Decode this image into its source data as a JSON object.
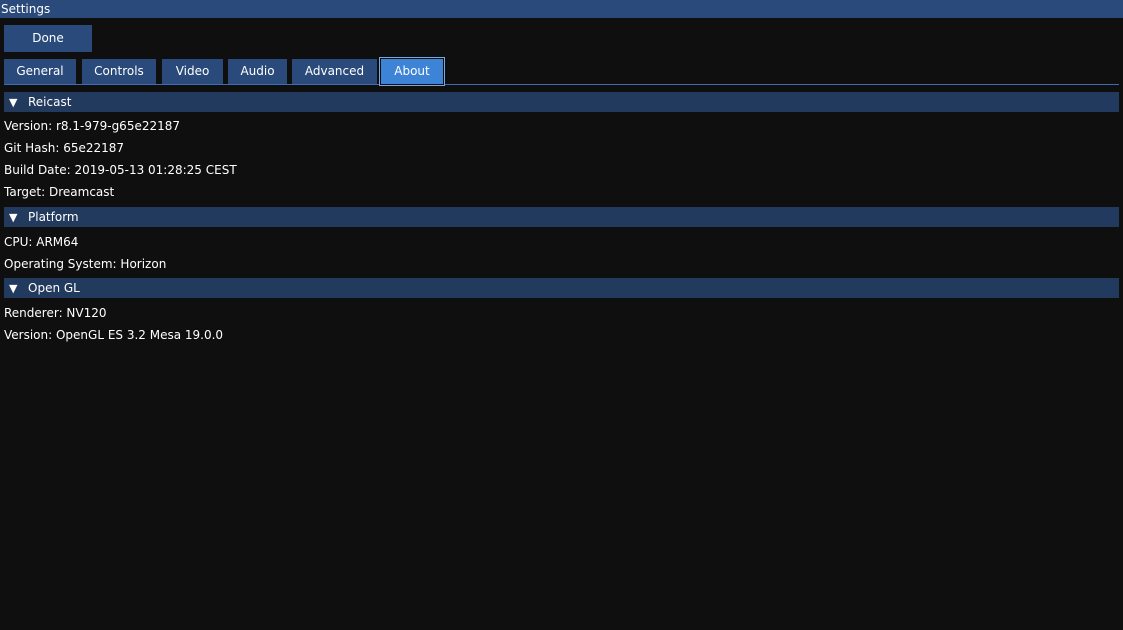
{
  "window": {
    "title": "Settings"
  },
  "toolbar": {
    "done_label": "Done"
  },
  "tabs": [
    {
      "label": "General"
    },
    {
      "label": "Controls"
    },
    {
      "label": "Video"
    },
    {
      "label": "Audio"
    },
    {
      "label": "Advanced"
    },
    {
      "label": "About",
      "active": true
    }
  ],
  "sections": {
    "reicast": {
      "arrow": "▼",
      "title": "Reicast",
      "lines": [
        "Version: r8.1-979-g65e22187",
        "Git Hash: 65e22187",
        "Build Date: 2019-05-13 01:28:25 CEST",
        "Target: Dreamcast"
      ]
    },
    "platform": {
      "arrow": "▼",
      "title": "Platform",
      "lines": [
        "CPU: ARM64",
        "Operating System: Horizon"
      ]
    },
    "opengl": {
      "arrow": "▼",
      "title": "Open GL",
      "lines": [
        "Renderer: NV120",
        "Version: OpenGL ES 3.2 Mesa 19.0.0"
      ]
    }
  },
  "colors": {
    "titlebar": "#294a7a",
    "button": "#294a7a",
    "active_tab": "#3d83d6",
    "section_header": "#223a5e",
    "background": "#0f0f0f"
  }
}
